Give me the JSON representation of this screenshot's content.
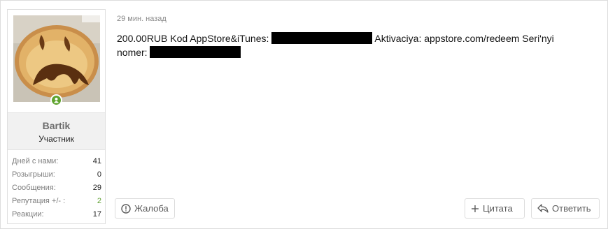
{
  "user": {
    "name": "Bartik",
    "title": "Участник",
    "avatar_icon": "sad-face-pancake-avatar",
    "online_icon": "user-online-icon",
    "stats": [
      {
        "label": "Дней с нами:",
        "value": "41"
      },
      {
        "label": "Розыгрыши:",
        "value": "0"
      },
      {
        "label": "Сообщения:",
        "value": "29"
      },
      {
        "label": "Репутация +/- :",
        "value": "2"
      },
      {
        "label": "Реакции:",
        "value": "17"
      }
    ]
  },
  "post": {
    "time": "29 мин. назад",
    "text_part1": "200.00RUB Kod AppStore&iTunes:",
    "text_part2": "Aktivaciya: appstore.com/redeem Seri'nyi nomer:"
  },
  "actions": {
    "report": "Жалоба",
    "quote": "Цитата",
    "reply": "Ответить"
  },
  "colors": {
    "online": "#5fa32e",
    "reputation": "#5d9e2f"
  }
}
